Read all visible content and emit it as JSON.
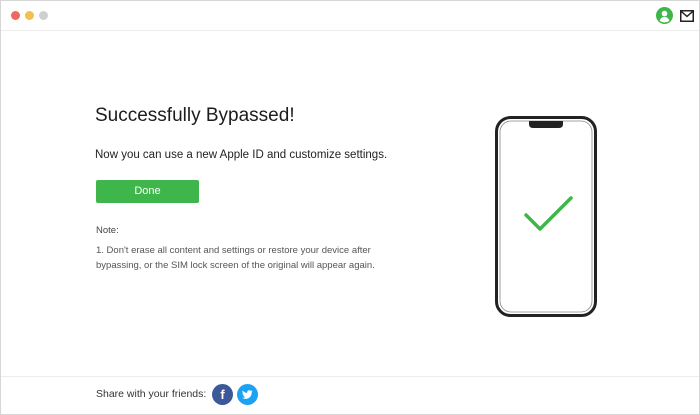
{
  "window": {
    "controls": [
      "close",
      "minimize",
      "maximize"
    ],
    "icons": [
      "account-icon",
      "mail-icon"
    ]
  },
  "main": {
    "title": "Successfully Bypassed!",
    "subtitle": "Now you can use a new Apple ID and customize settings.",
    "done_label": "Done",
    "note_label": "Note:",
    "note_text": "1. Don't erase all content and settings or restore your device after bypassing, or the SIM lock screen of the original will appear again."
  },
  "illustration": {
    "icon": "phone-with-checkmark",
    "check_color": "#3fb64b"
  },
  "footer": {
    "share_label": "Share with your friends:",
    "facebook_icon_text": "f",
    "social": [
      "facebook-icon",
      "twitter-icon"
    ]
  },
  "colors": {
    "accent": "#3fb64b",
    "facebook": "#3b5998",
    "twitter": "#1da1f2"
  }
}
